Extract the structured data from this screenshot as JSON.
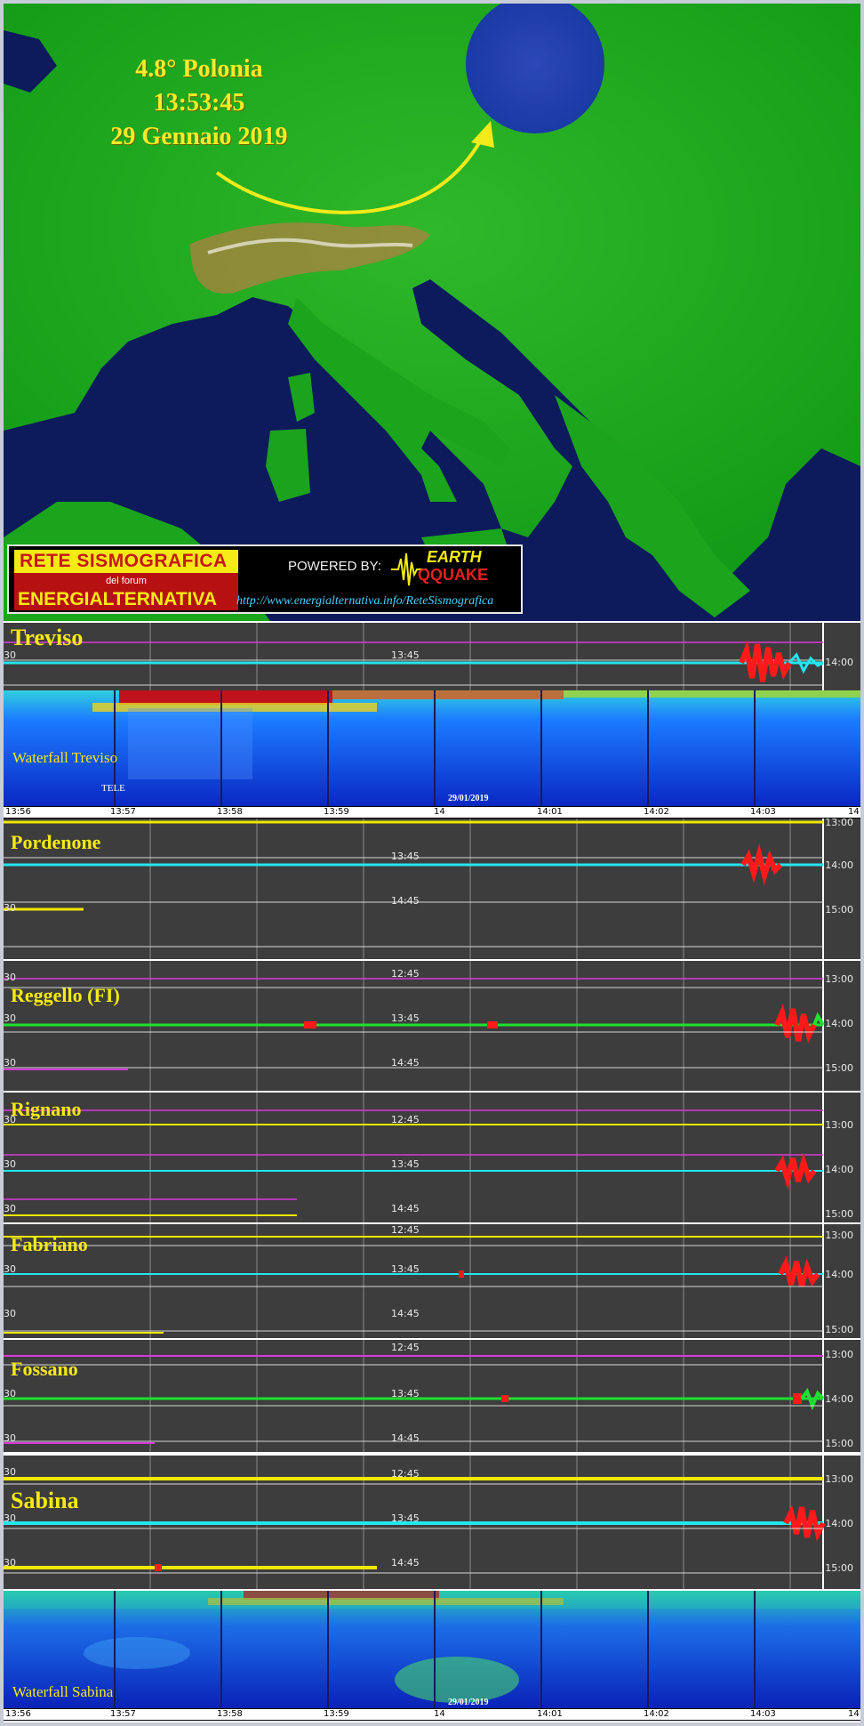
{
  "map": {
    "title_magnitude": "4.8° Polonia",
    "title_time": "13:53:45",
    "title_date": "29 Gennaio 2019"
  },
  "banner": {
    "logo_line1": "RETE SISMOGRAFICA",
    "logo_line2": "del forum",
    "logo_line3": "ENERGIALTERNATIVA",
    "powered_by": "POWERED BY:",
    "eq_line1": "EARTH",
    "eq_line2": "QQUAKE",
    "url": "http://www.energialternativa.info/ReteSismografica"
  },
  "colors": {
    "panel_bg": "#3d3d3d",
    "cyan_trace": "#22e6f0",
    "green_trace": "#1fe030",
    "yellow_trace": "#f0e800",
    "magenta_trace": "#d83ad8",
    "event_red": "#ff1a1a",
    "station_text": "#f6ea14"
  },
  "panels": [
    {
      "id": "treviso",
      "station": "Treviso",
      "left_labels": [
        "30"
      ],
      "center_labels": [
        "13:45"
      ],
      "right_labels": [
        "14:00"
      ]
    },
    {
      "id": "pordenone",
      "station": "Pordenone",
      "left_labels": [
        "30"
      ],
      "center_labels": [
        "13:45",
        "14:45"
      ],
      "right_labels": [
        "13:00",
        "14:00",
        "15:00"
      ]
    },
    {
      "id": "reggello",
      "station": "Reggello (FI)",
      "left_labels": [
        "30",
        "30",
        "30"
      ],
      "center_labels": [
        "12:45",
        "13:45",
        "14:45"
      ],
      "right_labels": [
        "13:00",
        "14:00",
        "15:00"
      ]
    },
    {
      "id": "rignano",
      "station": "Rignano",
      "left_labels": [
        "30",
        "30",
        "30"
      ],
      "center_labels": [
        "12:45",
        "13:45",
        "14:45"
      ],
      "right_labels": [
        "13:00",
        "14:00",
        "15:00"
      ]
    },
    {
      "id": "fabriano",
      "station": "Fabriano",
      "left_labels": [
        "30",
        "30"
      ],
      "center_labels": [
        "12:45",
        "13:45",
        "14:45"
      ],
      "right_labels": [
        "13:00",
        "14:00",
        "15:00"
      ]
    },
    {
      "id": "fossano",
      "station": "Fossano",
      "left_labels": [
        "30",
        "30"
      ],
      "center_labels": [
        "12:45",
        "13:45",
        "14:45"
      ],
      "right_labels": [
        "13:00",
        "14:00",
        "15:00"
      ]
    },
    {
      "id": "sabina",
      "station": "Sabina",
      "left_labels": [
        "30",
        "30",
        "30"
      ],
      "center_labels": [
        "12:45",
        "13:45",
        "14:45"
      ],
      "right_labels": [
        "13:00",
        "14:00",
        "15:00"
      ]
    }
  ],
  "waterfalls": [
    {
      "id": "wf-treviso",
      "label": "Waterfall Treviso",
      "date": "29/01/2019",
      "tag": "TELE"
    },
    {
      "id": "wf-sabina",
      "label": "Waterfall Sabina",
      "date": "29/01/2019"
    }
  ],
  "time_axis": [
    "13:56",
    "13:57",
    "13:58",
    "13:59",
    "14",
    "14:01",
    "14:02",
    "14:03",
    "14"
  ]
}
